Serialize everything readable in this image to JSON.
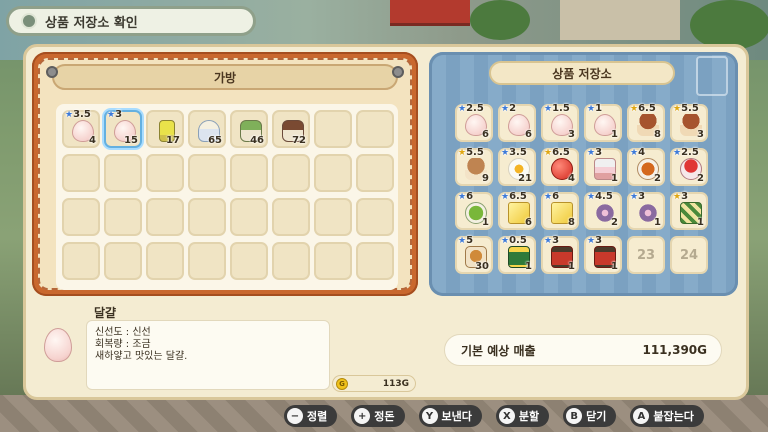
{
  "window": {
    "title": "상품 저장소 확인"
  },
  "bag": {
    "title": "가방",
    "slots": [
      {
        "rank": "3.5",
        "rank_color": "blue",
        "icon": "egg-icon",
        "item_class": "egg",
        "qty": "4",
        "selected": false
      },
      {
        "rank": "3",
        "rank_color": "blue",
        "icon": "egg-icon",
        "item_class": "egg",
        "qty": "15",
        "selected": true
      },
      {
        "rank": "",
        "rank_color": "",
        "icon": "oil-bottle-icon",
        "item_class": "bottle milk-oil",
        "qty": "17",
        "selected": false
      },
      {
        "rank": "",
        "rank_color": "",
        "icon": "milk-bottle-icon",
        "item_class": "milk-g",
        "qty": "65",
        "selected": false
      },
      {
        "rank": "",
        "rank_color": "",
        "icon": "green-jar-icon",
        "item_class": "jar-g",
        "qty": "46",
        "selected": false
      },
      {
        "rank": "",
        "rank_color": "",
        "icon": "brown-jar-icon",
        "item_class": "jar-b",
        "qty": "72",
        "selected": false
      },
      {},
      {},
      {},
      {},
      {},
      {},
      {},
      {},
      {},
      {},
      {},
      {},
      {},
      {},
      {},
      {},
      {},
      {},
      {},
      {},
      {},
      {},
      {},
      {},
      {},
      {}
    ]
  },
  "storage": {
    "title": "상품 저장소",
    "slots": [
      {
        "rank": "2.5",
        "rank_color": "blue",
        "icon": "egg-icon",
        "item_class": "egg",
        "qty": "6"
      },
      {
        "rank": "2",
        "rank_color": "blue",
        "icon": "egg-icon",
        "item_class": "egg",
        "qty": "6"
      },
      {
        "rank": "1.5",
        "rank_color": "blue",
        "icon": "egg-icon",
        "item_class": "egg",
        "qty": "3"
      },
      {
        "rank": "1",
        "rank_color": "blue",
        "icon": "egg-icon",
        "item_class": "egg",
        "qty": "1"
      },
      {
        "rank": "6.5",
        "rank_color": "gold",
        "icon": "mushroom-icon",
        "item_class": "mushroom",
        "qty": "8"
      },
      {
        "rank": "5.5",
        "rank_color": "gold",
        "icon": "mushroom-icon",
        "item_class": "mushroom",
        "qty": "3"
      },
      {
        "rank": "5.5",
        "rank_color": "gold",
        "icon": "brown-mushroom-icon",
        "item_class": "mushroom-b",
        "qty": "9"
      },
      {
        "rank": "3.5",
        "rank_color": "blue",
        "icon": "fried-egg-icon",
        "item_class": "friedegg",
        "qty": "21"
      },
      {
        "rank": "6.5",
        "rank_color": "gold",
        "icon": "tomato-dish-icon",
        "item_class": "tomato",
        "qty": "4"
      },
      {
        "rank": "3",
        "rank_color": "blue",
        "icon": "cake-icon",
        "item_class": "cake",
        "qty": "1"
      },
      {
        "rank": "4",
        "rank_color": "blue",
        "icon": "tea-icon",
        "item_class": "tea",
        "qty": "2"
      },
      {
        "rank": "2.5",
        "rank_color": "blue",
        "icon": "strawberry-cake-icon",
        "item_class": "strawcake",
        "qty": "2"
      },
      {
        "rank": "6",
        "rank_color": "blue",
        "icon": "green-tea-icon",
        "item_class": "greentea",
        "qty": "1"
      },
      {
        "rank": "6.5",
        "rank_color": "blue",
        "icon": "butter-icon",
        "item_class": "butter",
        "qty": "6"
      },
      {
        "rank": "6",
        "rank_color": "blue",
        "icon": "butter-icon",
        "item_class": "butter",
        "qty": "8"
      },
      {
        "rank": "4.5",
        "rank_color": "blue",
        "icon": "flower-icon",
        "item_class": "flower",
        "qty": "2"
      },
      {
        "rank": "3",
        "rank_color": "blue",
        "icon": "flower-icon",
        "item_class": "flower",
        "qty": "1"
      },
      {
        "rank": "3",
        "rank_color": "gold",
        "icon": "wrapped-item-icon",
        "item_class": "wrap",
        "qty": "1"
      },
      {
        "rank": "5",
        "rank_color": "blue",
        "icon": "bread-icon",
        "item_class": "bread",
        "qty": "30"
      },
      {
        "rank": "0.5",
        "rank_color": "blue",
        "icon": "green-seed-bag-icon",
        "item_class": "seed-green",
        "qty": "1"
      },
      {
        "rank": "3",
        "rank_color": "blue",
        "icon": "red-seed-bag-icon",
        "item_class": "seed-red",
        "qty": "1"
      },
      {
        "rank": "3",
        "rank_color": "blue",
        "icon": "red-seed-bag-icon",
        "item_class": "seed-red",
        "qty": "1"
      },
      {
        "empty_number": "23"
      },
      {
        "empty_number": "24"
      }
    ]
  },
  "details": {
    "icon": "egg-icon",
    "name": "달걀",
    "lines": [
      "신선도 : 신선",
      "회복량 : 조금",
      "새하얗고 맛있는 달걀."
    ]
  },
  "gold": {
    "coin_letter": "G",
    "amount": "113G"
  },
  "sales": {
    "label": "기본 예상 매출",
    "value": "111,390G"
  },
  "hints": [
    {
      "button": "−",
      "label": "정렬"
    },
    {
      "button": "+",
      "label": "정돈"
    },
    {
      "button": "Y",
      "label": "보낸다"
    },
    {
      "button": "X",
      "label": "분할"
    },
    {
      "button": "B",
      "label": "닫기"
    },
    {
      "button": "A",
      "label": "붙잡는다"
    }
  ]
}
